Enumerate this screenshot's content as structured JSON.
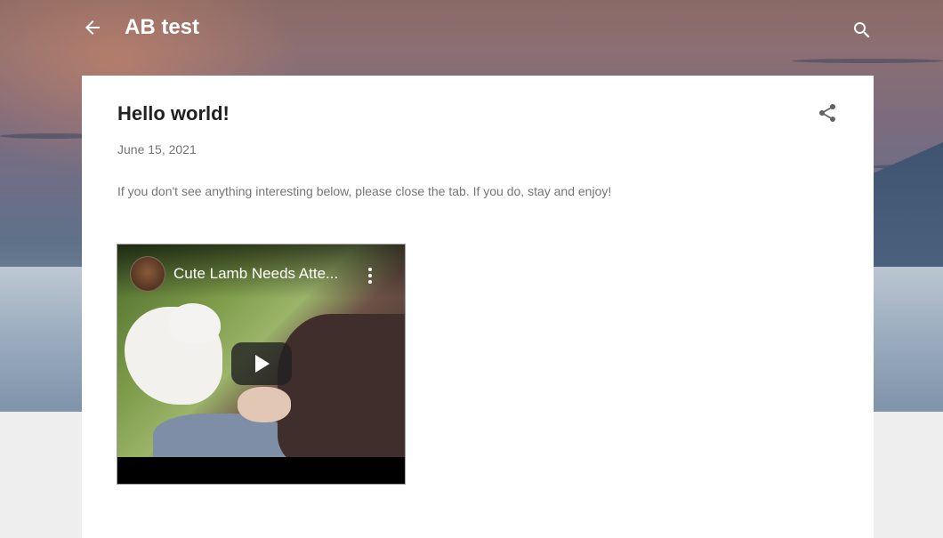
{
  "header": {
    "blog_title": "AB test",
    "back_icon": "arrow-back-icon",
    "search_icon": "search-icon"
  },
  "post": {
    "title": "Hello world!",
    "date": "June 15, 2021",
    "body": "If you don't see anything interesting below, please close the tab. If you do, stay and enjoy!",
    "share_icon": "share-icon"
  },
  "video": {
    "title": "Cute Lamb Needs Atte...",
    "menu_icon": "more-vert-icon",
    "play_icon": "play-icon"
  },
  "colors": {
    "title_text": "#212121",
    "meta_text": "#757575",
    "card_bg": "#ffffff",
    "page_bg": "#eeeeee",
    "header_text": "#ffffff"
  }
}
